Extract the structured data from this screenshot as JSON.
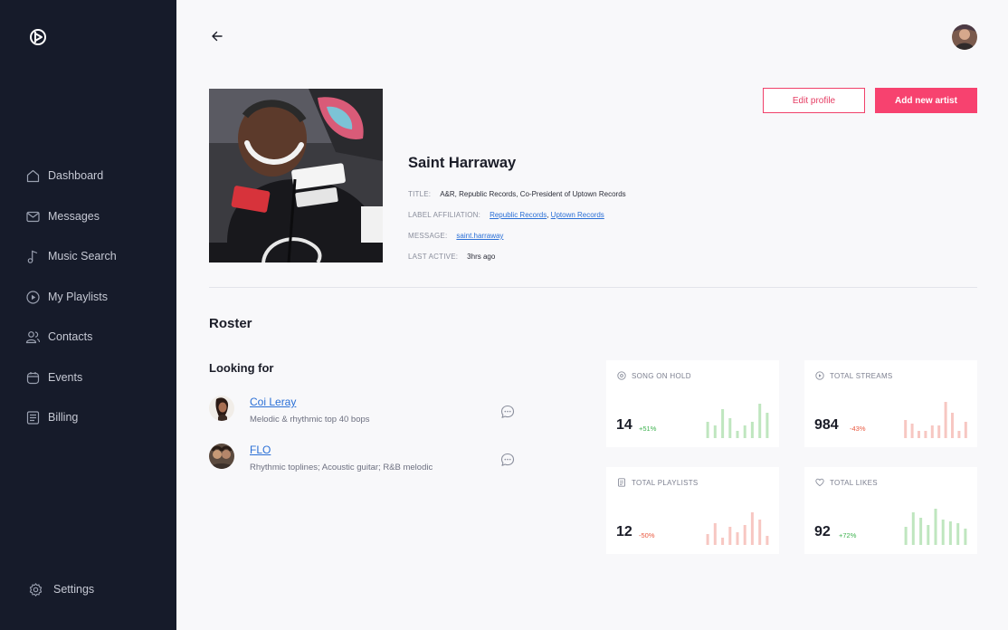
{
  "sidebar": {
    "items": [
      {
        "label": "Dashboard",
        "icon": "home-icon"
      },
      {
        "label": "Messages",
        "icon": "mail-icon"
      },
      {
        "label": "Music Search",
        "icon": "music-note-icon"
      },
      {
        "label": "My Playlists",
        "icon": "play-circle-icon"
      },
      {
        "label": "Contacts",
        "icon": "users-icon"
      },
      {
        "label": "Events",
        "icon": "calendar-icon"
      },
      {
        "label": "Billing",
        "icon": "receipt-icon"
      }
    ],
    "settings_label": "Settings"
  },
  "profile": {
    "name": "Saint Harraway",
    "title_label": "TITLE:",
    "title_value": "A&R, Republic Records, Co-President of Uptown Records",
    "label_affiliation_label": "LABEL AFFILIATION:",
    "label_1": "Republic Records",
    "label_sep": ", ",
    "label_2": "Uptown Records",
    "message_label": "MESSAGE:",
    "message_value": "saint.harraway",
    "last_active_label": "LAST ACTIVE:",
    "last_active_value": "3hrs ago"
  },
  "actions": {
    "edit_label": "Edit profile",
    "add_label": "Add new artist"
  },
  "roster": {
    "title": "Roster",
    "looking_for_title": "Looking for",
    "people": [
      {
        "name": "Coi Leray",
        "description": "Melodic & rhythmic top 40 bops"
      },
      {
        "name": "FLO",
        "description": "Rhythmic toplines; Acoustic guitar; R&B melodic"
      }
    ]
  },
  "stats": [
    {
      "title": "SONG ON HOLD",
      "value": "14",
      "delta": "+51%",
      "trend": "up",
      "icon": "disc-icon",
      "color": "#bfe6bf",
      "bars": [
        0.45,
        0.35,
        0.8,
        0.55,
        0.2,
        0.35,
        0.45,
        0.95,
        0.7
      ]
    },
    {
      "title": "TOTAL STREAMS",
      "value": "984",
      "delta": "-43%",
      "trend": "down",
      "icon": "play-circle-icon",
      "color": "#f7c7c2",
      "bars": [
        0.5,
        0.4,
        0.2,
        0.2,
        0.35,
        0.35,
        1.0,
        0.7,
        0.2,
        0.45
      ]
    },
    {
      "title": "TOTAL PLAYLISTS",
      "value": "12",
      "delta": "-50%",
      "trend": "down",
      "icon": "document-icon",
      "color": "#f7c7c2",
      "bars": [
        0.3,
        0.6,
        0.2,
        0.5,
        0.35,
        0.55,
        0.9,
        0.7,
        0.25
      ]
    },
    {
      "title": "TOTAL LIKES",
      "value": "92",
      "delta": "+72%",
      "trend": "up",
      "icon": "heart-icon",
      "color": "#bfe6bf",
      "bars": [
        0.5,
        0.9,
        0.75,
        0.55,
        1.0,
        0.7,
        0.65,
        0.6,
        0.45
      ]
    }
  ]
}
